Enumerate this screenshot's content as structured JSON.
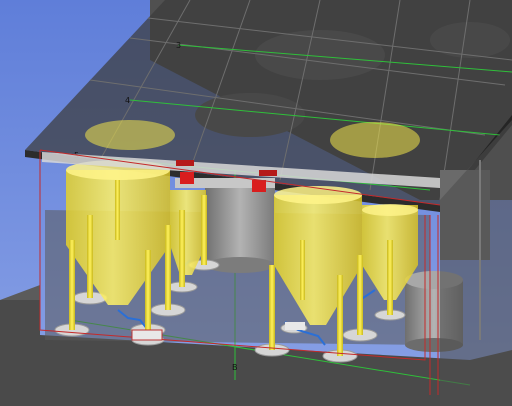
{
  "viewport": {
    "background_top": "#5f7ed9",
    "background_bottom": "#8aa2e6"
  },
  "grid_labels": {
    "row_3": "3",
    "row_4": "4",
    "row_5": "5",
    "col_b": "B"
  },
  "colors": {
    "tank_yellow": "#f3e64a",
    "steel_grey": "#8f8f8f",
    "roof_grey": "#3a3a3a",
    "gridline_green": "#2fbf3a",
    "outline_red": "#c42a2a",
    "pipe_blue": "#2b6fd6",
    "valve_red": "#d91e1e"
  }
}
